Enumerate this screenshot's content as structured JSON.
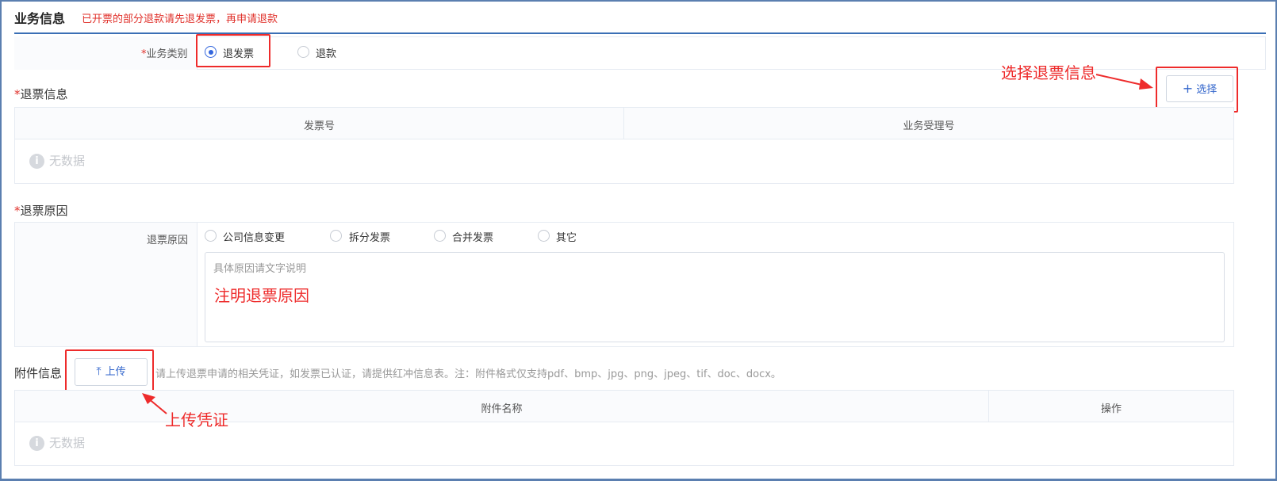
{
  "header": {
    "title": "业务信息",
    "note": "已开票的部分退款请先退发票，再申请退款"
  },
  "business_type": {
    "required_mark": "*",
    "label": "业务类别",
    "options": [
      {
        "label": "退发票",
        "checked": true
      },
      {
        "label": "退款",
        "checked": false
      }
    ]
  },
  "invoice_info": {
    "required_mark": "*",
    "title": "退票信息",
    "select_button": "选择",
    "columns": [
      "发票号",
      "业务受理号"
    ],
    "empty_text": "无数据"
  },
  "reason": {
    "required_mark": "*",
    "title": "退票原因",
    "label": "退票原因",
    "options": [
      "公司信息变更",
      "拆分发票",
      "合并发票",
      "其它"
    ],
    "placeholder": "具体原因请文字说明"
  },
  "attachment": {
    "title": "附件信息",
    "upload_button": "上传",
    "hint": "请上传退票申请的相关凭证，如发票已认证，请提供红冲信息表。注：附件格式仅支持pdf、bmp、jpg、png、jpeg、tif、doc、docx。",
    "columns": [
      "附件名称",
      "操作"
    ],
    "empty_text": "无数据"
  },
  "annotations": {
    "select_invoice": "选择退票信息",
    "reason_note": "注明退票原因",
    "upload_note": "上传凭证"
  },
  "colors": {
    "accent": "#3366dd",
    "annotation": "#ee2b2b",
    "title_rule": "#3a6fb5"
  }
}
